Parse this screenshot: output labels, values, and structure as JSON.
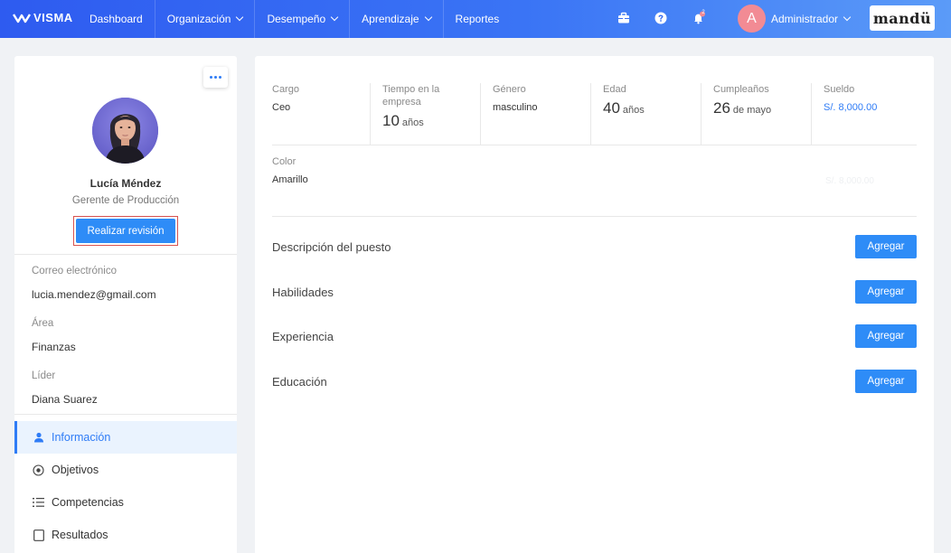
{
  "header": {
    "logo_text": "VISMA",
    "nav": [
      {
        "label": "Dashboard",
        "dropdown": false
      },
      {
        "label": "Organización",
        "dropdown": true
      },
      {
        "label": "Desempeño",
        "dropdown": true
      },
      {
        "label": "Aprendizaje",
        "dropdown": true
      },
      {
        "label": "Reportes",
        "dropdown": false
      }
    ],
    "notification_count": "2",
    "avatar_letter": "A",
    "user_label": "Administrador",
    "brand": "mandü",
    "icons": [
      "briefcase-icon",
      "help-icon",
      "bell-icon"
    ]
  },
  "profile": {
    "name": "Lucía Méndez",
    "role": "Gerente de Producción",
    "review_button": "Realizar revisión",
    "email_label": "Correo electrónico",
    "email": "lucia.mendez@gmail.com",
    "area_label": "Área",
    "area": "Finanzas",
    "leader_label": "Líder",
    "leader": "Diana Suarez"
  },
  "menu": [
    {
      "label": "Información",
      "icon": "user-icon",
      "active": true
    },
    {
      "label": "Objetivos",
      "icon": "target-icon",
      "active": false
    },
    {
      "label": "Competencias",
      "icon": "list-icon",
      "active": false
    },
    {
      "label": "Resultados",
      "icon": "square-icon",
      "active": false
    }
  ],
  "details": {
    "cargo": {
      "label": "Cargo",
      "value": "Ceo"
    },
    "tiempo": {
      "label": "Tiempo en la empresa",
      "value": "10",
      "unit": "años"
    },
    "genero": {
      "label": "Género",
      "value": "masculino"
    },
    "edad": {
      "label": "Edad",
      "value": "40",
      "unit": "años"
    },
    "cumple": {
      "label": "Cumpleaños",
      "value": "26",
      "unit": "de mayo"
    },
    "sueldo": {
      "label": "Sueldo",
      "value": "S/. 8,000.00"
    },
    "color": {
      "label": "Color",
      "value": "Amarillo"
    },
    "ghost_value": "S/. 8,000.00"
  },
  "sections": [
    {
      "title": "Descripción del puesto",
      "button": "Agregar"
    },
    {
      "title": "Habilidades",
      "button": "Agregar"
    },
    {
      "title": "Experiencia",
      "button": "Agregar"
    },
    {
      "title": "Educación",
      "button": "Agregar"
    }
  ],
  "colors": {
    "primary": "#2e8cf7",
    "active_menu_bg": "#eaf3fe",
    "highlight_border": "#d9534f"
  }
}
